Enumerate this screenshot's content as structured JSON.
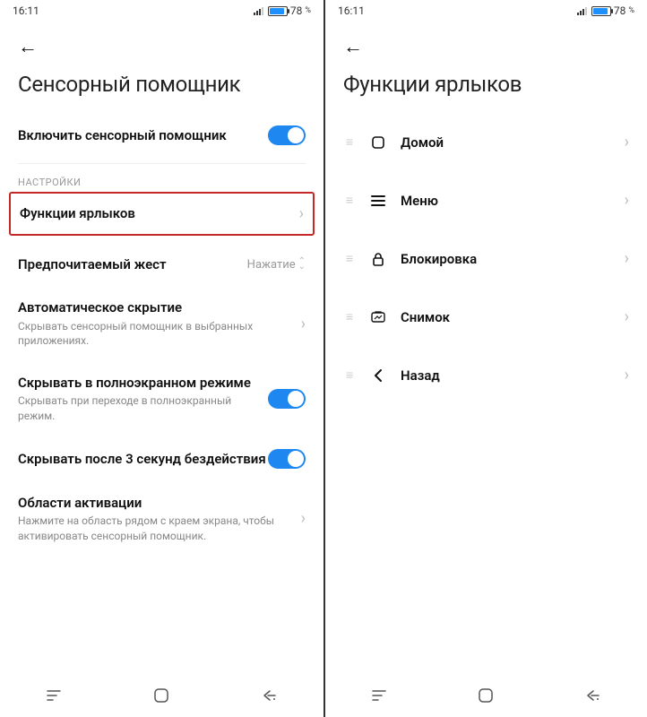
{
  "status": {
    "time": "16:11",
    "battery": "78"
  },
  "left": {
    "title": "Сенсорный помощник",
    "enable_label": "Включить сенсорный помощник",
    "section_label": "НАСТРОЙКИ",
    "shortcuts_label": "Функции ярлыков",
    "gesture": {
      "label": "Предпочитаемый жест",
      "value": "Нажатие"
    },
    "autohide": {
      "label": "Автоматическое скрытие",
      "sub": "Скрывать сенсорный помощник в выбранных приложениях."
    },
    "fullscreen": {
      "label": "Скрывать в полноэкранном режиме",
      "sub": "Скрывать при переходе в полноэкранный режим."
    },
    "idle": {
      "label": "Скрывать после 3 секунд бездействия"
    },
    "areas": {
      "label": "Области активации",
      "sub": "Нажмите на область рядом с краем экрана, чтобы активировать сенсорный помощник."
    }
  },
  "right": {
    "title": "Функции ярлыков",
    "items": [
      {
        "label": "Домой",
        "icon": "home"
      },
      {
        "label": "Меню",
        "icon": "menu"
      },
      {
        "label": "Блокировка",
        "icon": "lock"
      },
      {
        "label": "Снимок",
        "icon": "screenshot"
      },
      {
        "label": "Назад",
        "icon": "back"
      }
    ]
  }
}
